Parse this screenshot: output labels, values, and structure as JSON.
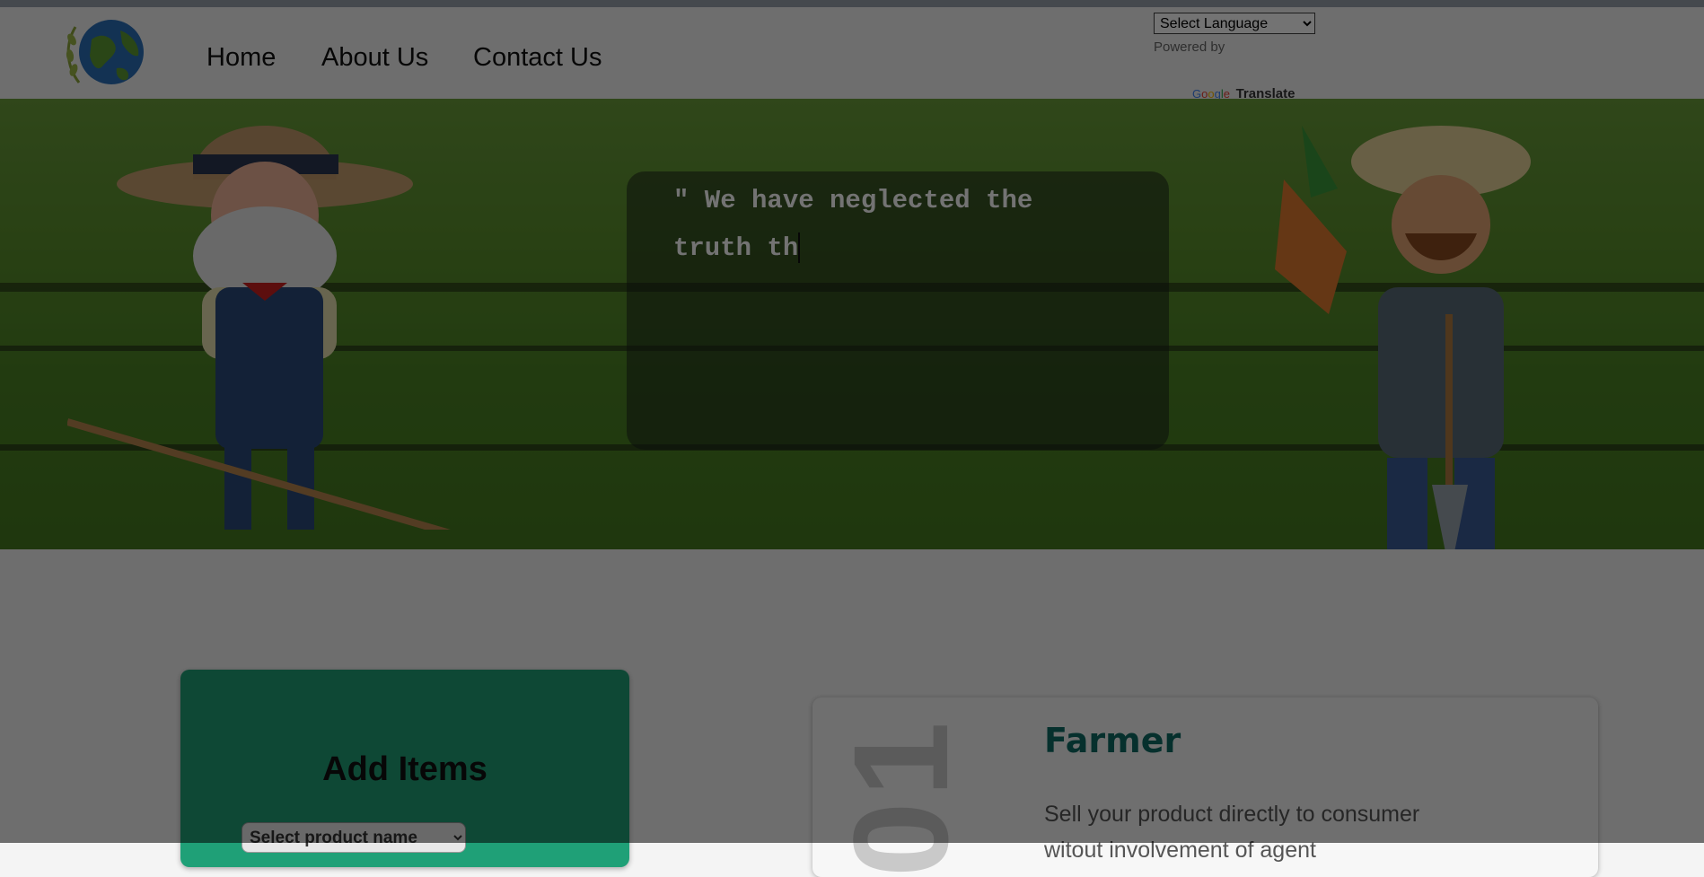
{
  "nav": {
    "items": [
      "Home",
      "About Us",
      "Contact Us"
    ]
  },
  "translate": {
    "select_label": "Select Language",
    "powered_by": "Powered by",
    "google": "Google",
    "translate_word": "Translate"
  },
  "hero": {
    "quote_line1": "\" We have neglected the",
    "quote_line2": "truth th"
  },
  "add_items": {
    "title": "Add Items",
    "select_placeholder": "Select product name"
  },
  "farmer": {
    "title": "Farmer",
    "number": "01",
    "desc_line1": "Sell your product directly to consumer",
    "desc_line2": "witout involvement of agent"
  },
  "colors": {
    "card_green": "#1fa077",
    "title_teal": "#0e6b64",
    "overlay": "rgba(0,0,0,0.55)"
  },
  "icons": [
    "globe-logo-icon",
    "chevron-down-icon"
  ]
}
